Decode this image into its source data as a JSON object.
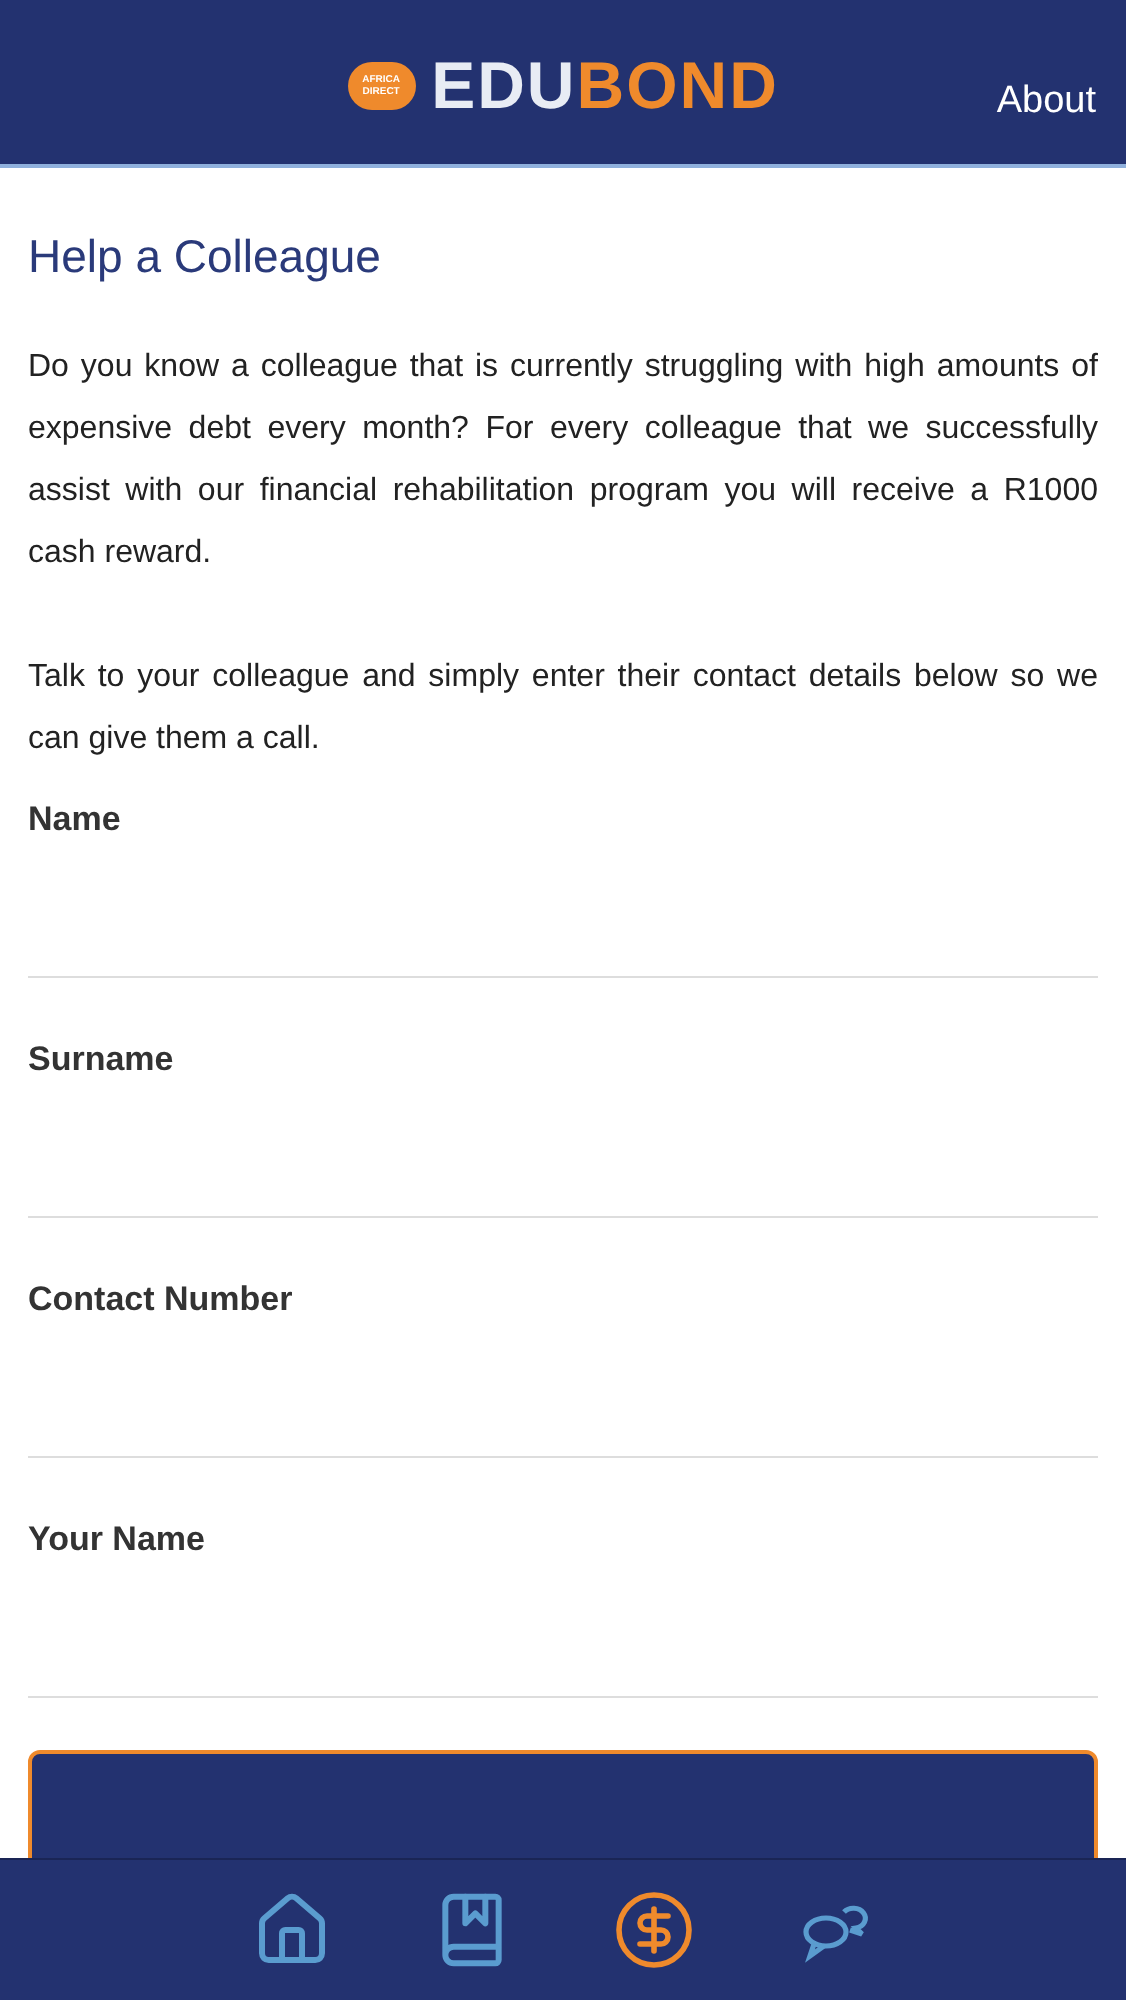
{
  "header": {
    "logo_badge": "AFRICA DIRECT",
    "logo_first": "EDU",
    "logo_second": "BOND",
    "link": "About"
  },
  "title": "Help a Colleague",
  "paragraphs": [
    "Do you know a colleague that is currently struggling with high amounts of expensive debt every month? For every colleague that we successfully assist with our financial rehabilitation program you will receive a R1000 cash reward.",
    "Talk to your colleague and simply enter their contact details below so we can give them a call."
  ],
  "fields": [
    {
      "label": "Name"
    },
    {
      "label": "Surname"
    },
    {
      "label": "Contact Number"
    },
    {
      "label": "Your Name"
    }
  ],
  "submit": {
    "kind": "button"
  },
  "tabs": [
    {
      "kind": "home",
      "selected": false
    },
    {
      "kind": "book",
      "selected": false
    },
    {
      "kind": "dollar",
      "selected": true
    },
    {
      "kind": "chat",
      "selected": false
    }
  ]
}
